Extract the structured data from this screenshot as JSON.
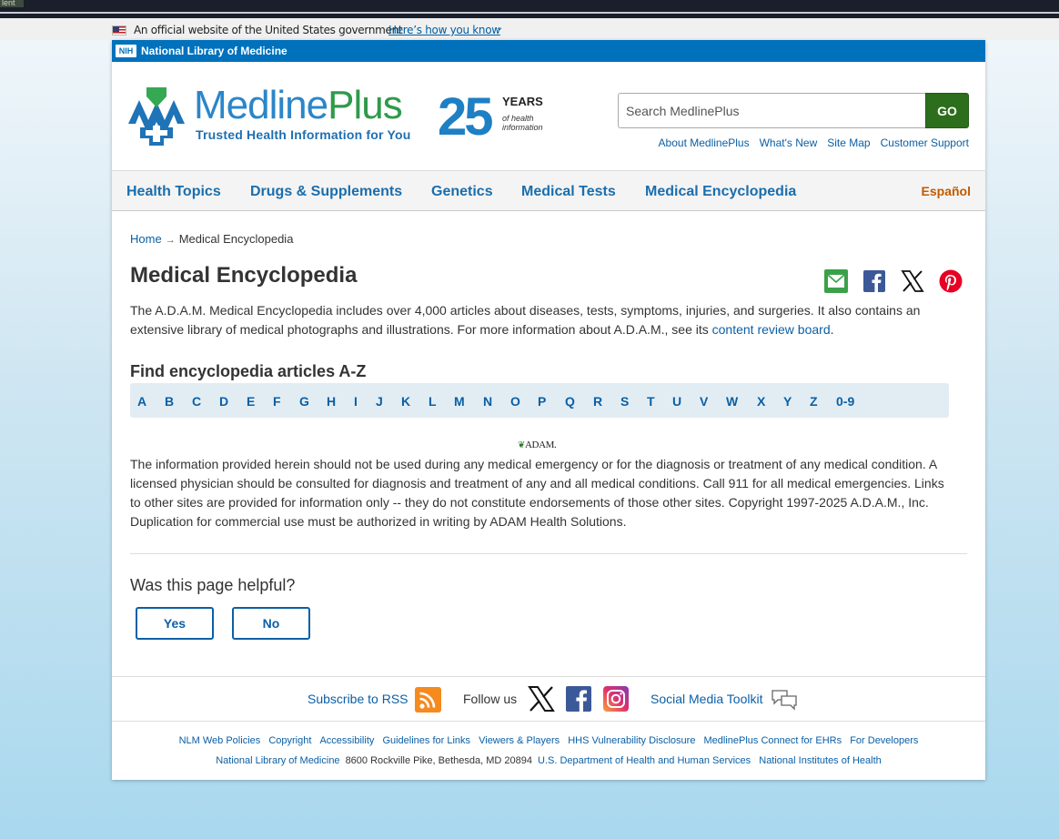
{
  "browser": {
    "tab_fragment": "lent"
  },
  "gov_banner": {
    "text": "An official website of the United States government",
    "how_link": "Here’s how you know",
    "chevron": "⌄"
  },
  "nlm_bar": {
    "badge": "NIH",
    "name": "National Library of Medicine"
  },
  "brand": {
    "word_medline": "Medline",
    "word_plus": "Plus",
    "tagline": "Trusted Health Information for You",
    "years_number": "25",
    "years_label": "YEARS",
    "years_sub_1": "of health",
    "years_sub_2": "information"
  },
  "search": {
    "placeholder": "Search MedlinePlus",
    "button": "GO"
  },
  "top_links": [
    "About MedlinePlus",
    "What's New",
    "Site Map",
    "Customer Support"
  ],
  "nav": {
    "items": [
      "Health Topics",
      "Drugs & Supplements",
      "Genetics",
      "Medical Tests",
      "Medical Encyclopedia"
    ],
    "espanol": "Español"
  },
  "breadcrumb": {
    "home": "Home",
    "arrow": "→",
    "current": "Medical Encyclopedia"
  },
  "page_title": "Medical Encyclopedia",
  "intro": {
    "text": "The A.D.A.M. Medical Encyclopedia includes over 4,000 articles about diseases, tests, symptoms, injuries, and surgeries. It also contains an extensive library of medical photographs and illustrations. For more information about A.D.A.M., see its ",
    "link": "content review board",
    "end": "."
  },
  "az": {
    "heading": "Find encyclopedia articles A-Z",
    "letters": [
      "A",
      "B",
      "C",
      "D",
      "E",
      "F",
      "G",
      "H",
      "I",
      "J",
      "K",
      "L",
      "M",
      "N",
      "O",
      "P",
      "Q",
      "R",
      "S",
      "T",
      "U",
      "V",
      "W",
      "X",
      "Y",
      "Z",
      "0-9"
    ]
  },
  "adam_logo": {
    "mark": "❦",
    "text": "ADAM."
  },
  "disclaimer": "The information provided herein should not be used during any medical emergency or for the diagnosis or treatment of any medical condition. A licensed physician should be consulted for diagnosis and treatment of any and all medical conditions. Call 911 for all medical emergencies. Links to other sites are provided for information only -- they do not constitute endorsements of those other sites. Copyright 1997-2025 A.D.A.M., Inc. Duplication for commercial use must be authorized in writing by ADAM Health Solutions.",
  "feedback": {
    "question": "Was this page helpful?",
    "yes": "Yes",
    "no": "No"
  },
  "social": {
    "rss": "Subscribe to RSS",
    "follow": "Follow us",
    "toolkit": "Social Media Toolkit"
  },
  "footer": {
    "row1": [
      "NLM Web Policies",
      "Copyright",
      "Accessibility",
      "Guidelines for Links",
      "Viewers & Players",
      "HHS Vulnerability Disclosure",
      "MedlinePlus Connect for EHRs",
      "For Developers"
    ],
    "row2_nlm": "National Library of Medicine",
    "row2_address": "8600 Rockville Pike, Bethesda, MD 20894",
    "row2_hhs": "U.S. Department of Health and Human Services",
    "row2_nih": "National Institutes of Health"
  },
  "colors": {
    "brand_blue": "#0071bc",
    "link": "#0b5fa5",
    "go_green": "#2c6e1b",
    "espanol": "#c35a00",
    "az_bg": "#e2edf3"
  }
}
